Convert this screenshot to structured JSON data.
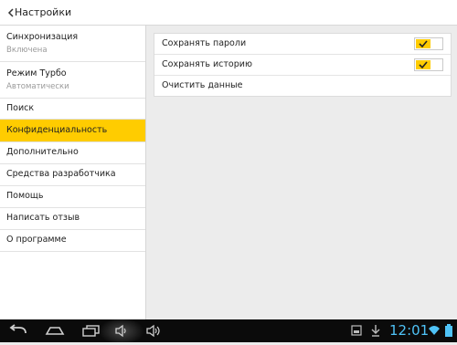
{
  "header": {
    "title": "Настройки"
  },
  "sidebar": {
    "items": [
      {
        "label": "Синхронизация",
        "sub": "Включена"
      },
      {
        "label": "Режим Турбо",
        "sub": "Автоматически"
      },
      {
        "label": "Поиск"
      },
      {
        "label": "Конфиденциальность",
        "active": true
      },
      {
        "label": "Дополнительно"
      },
      {
        "label": "Средства разработчика"
      },
      {
        "label": "Помощь"
      },
      {
        "label": "Написать отзыв"
      },
      {
        "label": "О программе"
      }
    ]
  },
  "privacy": {
    "rows": [
      {
        "label": "Сохранять пароли",
        "checked": true
      },
      {
        "label": "Сохранять историю",
        "checked": true
      },
      {
        "label": "Очистить данные"
      }
    ]
  },
  "colors": {
    "accent": "#ffcc00",
    "clock": "#4fc3f7",
    "navbar": "#0b0b0b"
  },
  "statusbar": {
    "time": "12:01"
  },
  "icons": [
    "back-arrow-icon",
    "nav-back-icon",
    "nav-home-icon",
    "nav-recent-apps-icon",
    "volume-down-icon",
    "volume-up-icon",
    "screenshot-icon",
    "download-icon",
    "wifi-icon",
    "battery-icon",
    "checkmark-icon"
  ]
}
